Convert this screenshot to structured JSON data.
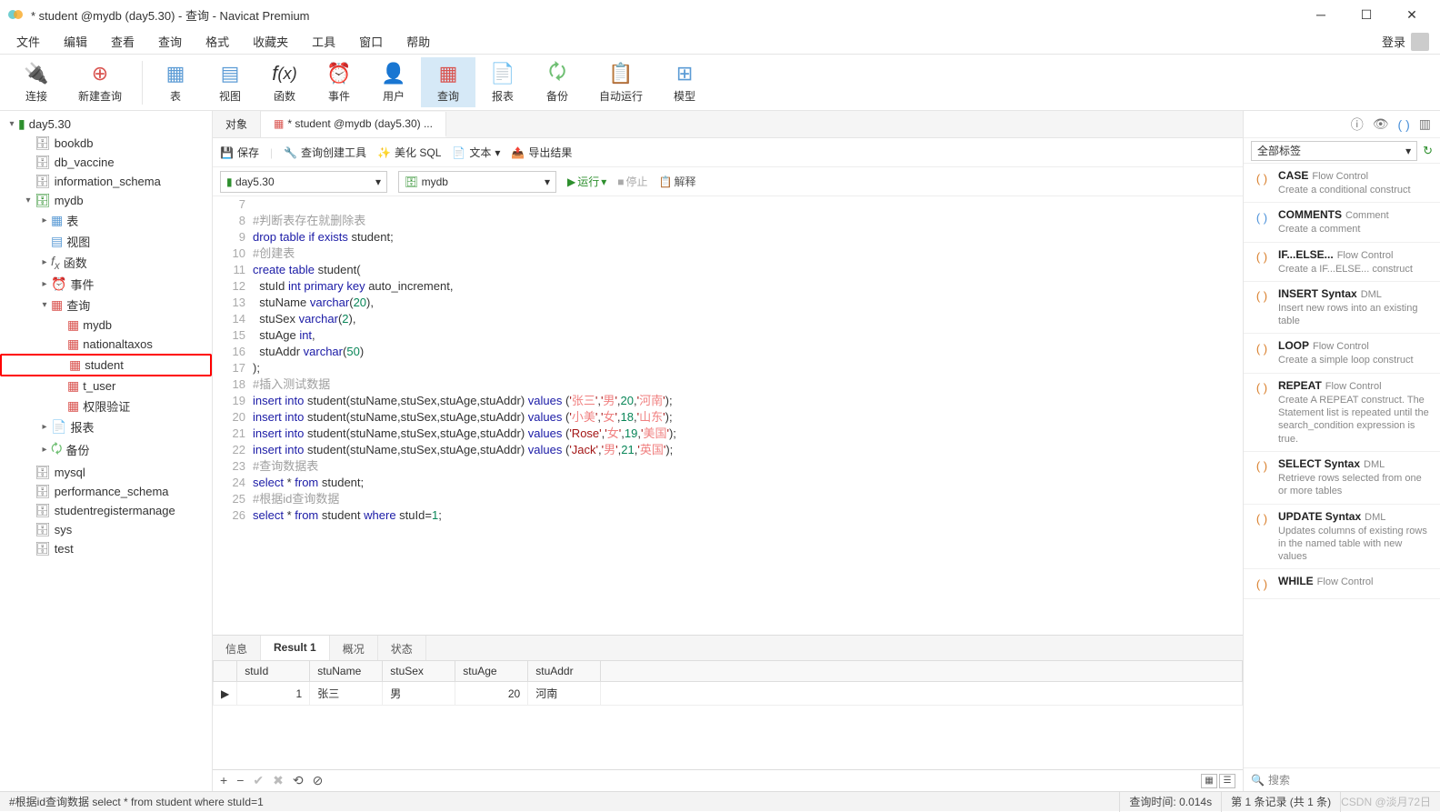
{
  "window": {
    "title": "* student @mydb (day5.30) - 查询 - Navicat Premium"
  },
  "menu": [
    "文件",
    "编辑",
    "查看",
    "查询",
    "格式",
    "收藏夹",
    "工具",
    "窗口",
    "帮助"
  ],
  "login": "登录",
  "toolbar": {
    "connect": "连接",
    "newQuery": "新建查询",
    "table": "表",
    "view": "视图",
    "function": "函数",
    "event": "事件",
    "user": "用户",
    "query": "查询",
    "report": "报表",
    "backup": "备份",
    "autorun": "自动运行",
    "model": "模型"
  },
  "tree": {
    "root": "day5.30",
    "dbs": [
      "bookdb",
      "db_vaccine",
      "information_schema"
    ],
    "mydb": {
      "label": "mydb",
      "children": {
        "tables": "表",
        "views": "视图",
        "functions": "函数",
        "events": "事件",
        "queries": "查询",
        "queryItems": [
          "mydb",
          "nationaltaxos",
          "student",
          "t_user",
          "权限验证"
        ],
        "reports": "报表",
        "backups": "备份"
      }
    },
    "other": [
      "mysql",
      "performance_schema",
      "studentregistermanage",
      "sys",
      "test"
    ]
  },
  "tabs": {
    "objects": "对象",
    "active": "* student @mydb (day5.30) ..."
  },
  "queryToolbar": {
    "save": "保存",
    "queryBuilder": "查询创建工具",
    "beautify": "美化 SQL",
    "text": "文本",
    "export": "导出结果"
  },
  "dbRow": {
    "conn": "day5.30",
    "schema": "mydb",
    "run": "运行",
    "stop": "停止",
    "explain": "解释"
  },
  "code": {
    "lines": [
      {
        "n": 7,
        "t": ""
      },
      {
        "n": 8,
        "t": "#判断表存在就删除表"
      },
      {
        "n": 9,
        "t": "drop table if exists student;"
      },
      {
        "n": 10,
        "t": "#创建表"
      },
      {
        "n": 11,
        "t": "create table student("
      },
      {
        "n": 12,
        "t": "  stuId int primary key auto_increment,"
      },
      {
        "n": 13,
        "t": "  stuName varchar(20),"
      },
      {
        "n": 14,
        "t": "  stuSex varchar(2),"
      },
      {
        "n": 15,
        "t": "  stuAge int,"
      },
      {
        "n": 16,
        "t": "  stuAddr varchar(50)"
      },
      {
        "n": 17,
        "t": ");"
      },
      {
        "n": 18,
        "t": "#插入测试数据"
      },
      {
        "n": 19,
        "t": "insert into student(stuName,stuSex,stuAge,stuAddr) values ('张三','男',20,'河南');"
      },
      {
        "n": 20,
        "t": "insert into student(stuName,stuSex,stuAge,stuAddr) values ('小美','女',18,'山东');"
      },
      {
        "n": 21,
        "t": "insert into student(stuName,stuSex,stuAge,stuAddr) values ('Rose','女',19,'美国');"
      },
      {
        "n": 22,
        "t": "insert into student(stuName,stuSex,stuAge,stuAddr) values ('Jack','男',21,'英国');"
      },
      {
        "n": 23,
        "t": "#查询数据表"
      },
      {
        "n": 24,
        "t": "select * from student;"
      },
      {
        "n": 25,
        "t": "#根据id查询数据"
      },
      {
        "n": 26,
        "t": "select * from student where stuId=1;"
      }
    ]
  },
  "resultTabs": [
    "信息",
    "Result 1",
    "概况",
    "状态"
  ],
  "resultTable": {
    "headers": [
      "stuId",
      "stuName",
      "stuSex",
      "stuAge",
      "stuAddr"
    ],
    "rows": [
      [
        "1",
        "张三",
        "男",
        "20",
        "河南"
      ]
    ]
  },
  "rightPanel": {
    "tagFilter": "全部标签",
    "snippets": [
      {
        "title": "CASE",
        "cat": "Flow Control",
        "desc": "Create a conditional construct",
        "color": "orange"
      },
      {
        "title": "COMMENTS",
        "cat": "Comment",
        "desc": "Create a comment",
        "color": "blue"
      },
      {
        "title": "IF...ELSE...",
        "cat": "Flow Control",
        "desc": "Create a IF...ELSE... construct",
        "color": "orange"
      },
      {
        "title": "INSERT Syntax",
        "cat": "DML",
        "desc": "Insert new rows into an existing table",
        "color": "orange"
      },
      {
        "title": "LOOP",
        "cat": "Flow Control",
        "desc": "Create a simple loop construct",
        "color": "orange"
      },
      {
        "title": "REPEAT",
        "cat": "Flow Control",
        "desc": "Create A REPEAT construct. The Statement list is repeated until the search_condition expression is true.",
        "color": "orange"
      },
      {
        "title": "SELECT Syntax",
        "cat": "DML",
        "desc": "Retrieve rows selected from one or more tables",
        "color": "orange"
      },
      {
        "title": "UPDATE Syntax",
        "cat": "DML",
        "desc": "Updates columns of existing rows in the named table with new values",
        "color": "orange"
      },
      {
        "title": "WHILE",
        "cat": "Flow Control",
        "desc": "",
        "color": "orange"
      }
    ],
    "search": "搜索"
  },
  "statusbar": {
    "sql": "#根据id查询数据 select * from student where stuId=1",
    "time": "查询时间: 0.014s",
    "records": "第 1 条记录 (共 1 条)",
    "watermark": "CSDN @淡月72日"
  }
}
